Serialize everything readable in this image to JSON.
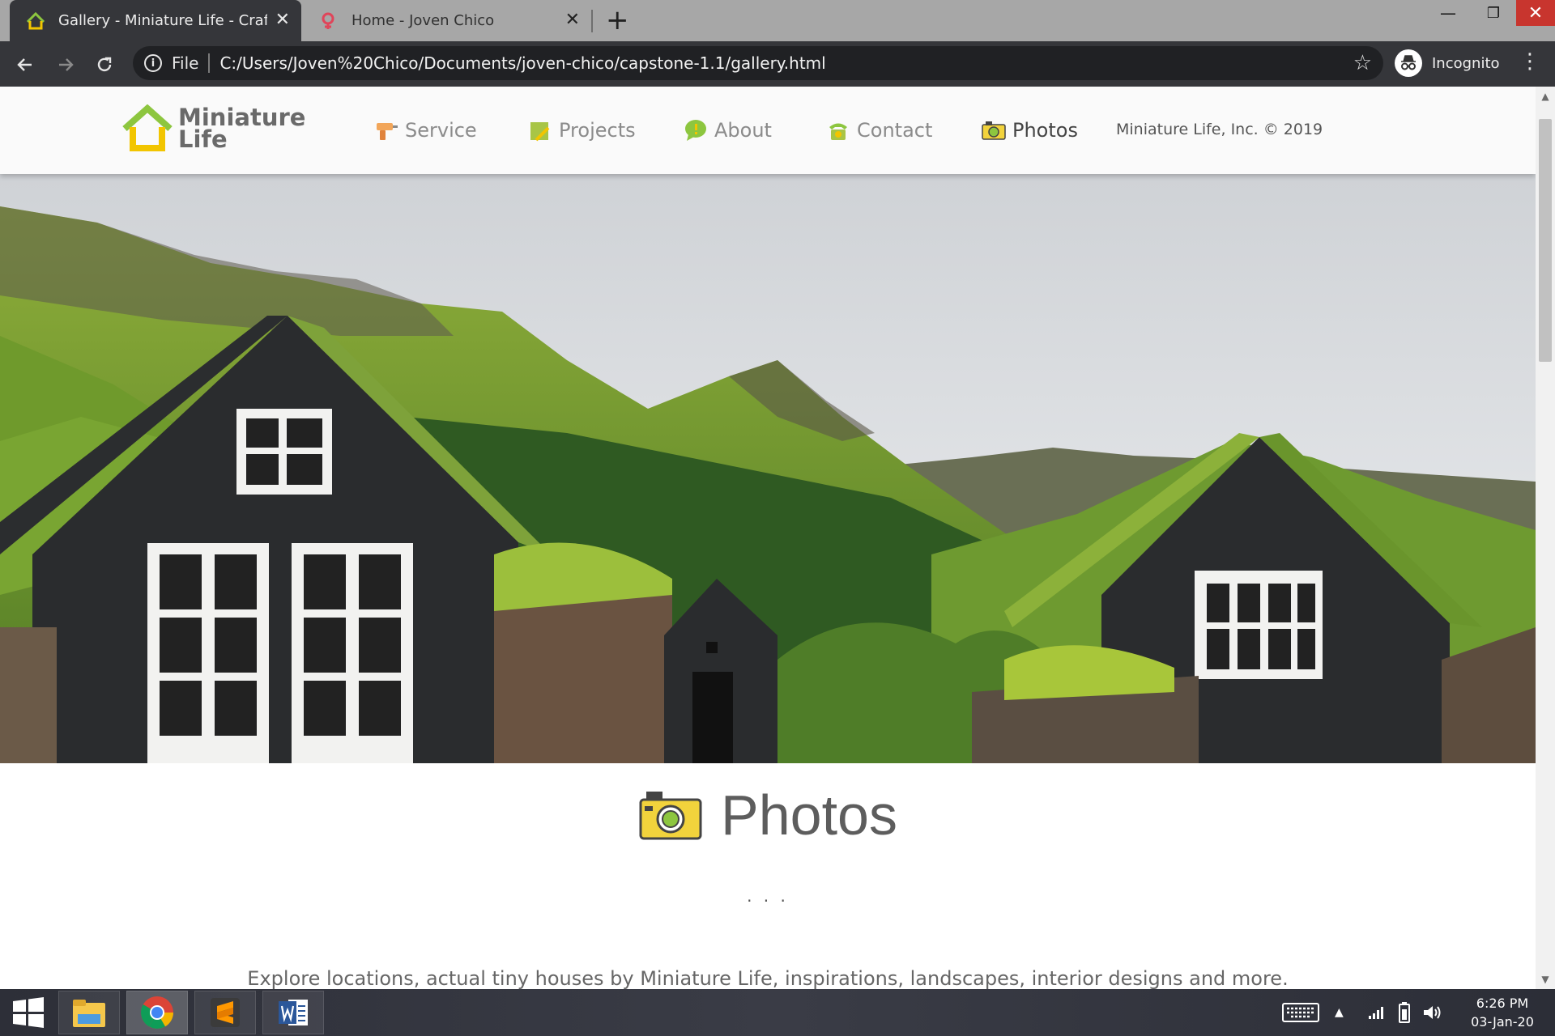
{
  "browser": {
    "tabs": [
      {
        "title": "Gallery - Miniature Life - Crafted",
        "active": true
      },
      {
        "title": "Home - Joven Chico",
        "active": false
      }
    ],
    "url_scheme": "File",
    "url": "C:/Users/Joven%20Chico/Documents/joven-chico/capstone-1.1/gallery.html",
    "profile_label": "Incognito"
  },
  "site": {
    "logo_line1": "Miniature",
    "logo_line2": "Life",
    "nav": [
      {
        "label": "Service",
        "icon": "drill-icon"
      },
      {
        "label": "Projects",
        "icon": "note-icon"
      },
      {
        "label": "About",
        "icon": "speech-bubble-icon"
      },
      {
        "label": "Contact",
        "icon": "telephone-icon"
      },
      {
        "label": "Photos",
        "icon": "camera-icon",
        "current": true
      }
    ],
    "copyright": "Miniature Life, Inc. © 2019",
    "section_title": "Photos",
    "ellipsis": ". . .",
    "intro_text": "Explore locations, actual tiny houses by Miniature Life, inspirations, landscapes, interior designs and more."
  },
  "taskbar": {
    "time": "6:26 PM",
    "date": "03-Jan-20",
    "apps": [
      "file-explorer-icon",
      "chrome-icon",
      "sublime-text-icon",
      "word-icon"
    ]
  },
  "colors": {
    "brand_green": "#8dc63f",
    "brand_yellow": "#f2c500",
    "chrome_dark": "#35363a"
  }
}
